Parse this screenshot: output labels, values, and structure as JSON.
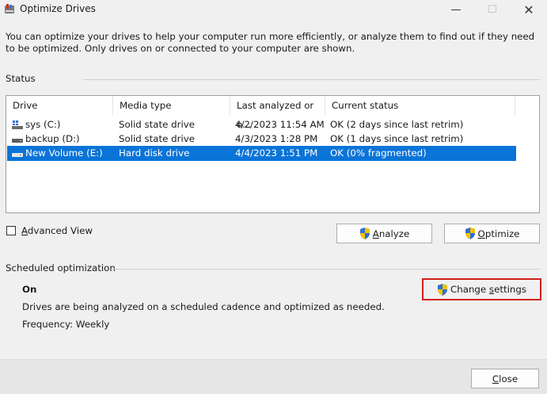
{
  "window": {
    "title": "Optimize Drives",
    "minimize_glyph": "—",
    "maximize_glyph": "☐",
    "close_glyph": "✕"
  },
  "description": "You can optimize your drives to help your computer run more efficiently, or analyze them to find out if they need to be optimized. Only drives on or connected to your computer are shown.",
  "status": {
    "label": "Status",
    "columns": [
      "Drive",
      "Media type",
      "Last analyzed or o...",
      "Current status"
    ],
    "rows": [
      {
        "drive": "sys (C:)",
        "media": "Solid state drive",
        "last": "4/2/2023 11:54 AM",
        "status": "OK (2 days since last retrim)",
        "icon": "system-drive-icon",
        "selected": false
      },
      {
        "drive": "backup (D:)",
        "media": "Solid state drive",
        "last": "4/3/2023 1:28 PM",
        "status": "OK (1 days since last retrim)",
        "icon": "drive-icon",
        "selected": false
      },
      {
        "drive": "New Volume (E:)",
        "media": "Hard disk drive",
        "last": "4/4/2023 1:51 PM",
        "status": "OK (0% fragmented)",
        "icon": "drive-icon",
        "selected": true
      }
    ]
  },
  "advanced_view": {
    "prefix": "",
    "mnemonic": "A",
    "rest": "dvanced View",
    "checked": false
  },
  "buttons": {
    "analyze": {
      "mnemonic": "A",
      "rest": "nalyze"
    },
    "optimize": {
      "mnemonic": "O",
      "rest": "ptimize"
    },
    "change_settings": {
      "prefix": "Change ",
      "mnemonic": "s",
      "rest": "ettings"
    },
    "close": {
      "mnemonic": "C",
      "rest": "lose"
    }
  },
  "scheduled": {
    "label": "Scheduled optimization",
    "state": "On",
    "description": "Drives are being analyzed on a scheduled cadence and optimized as needed.",
    "frequency": "Frequency: Weekly"
  },
  "colors": {
    "selection": "#0a74d8",
    "highlight_border": "#d0201c",
    "shield_blue": "#2f6fd6",
    "shield_yellow": "#f2c200"
  }
}
